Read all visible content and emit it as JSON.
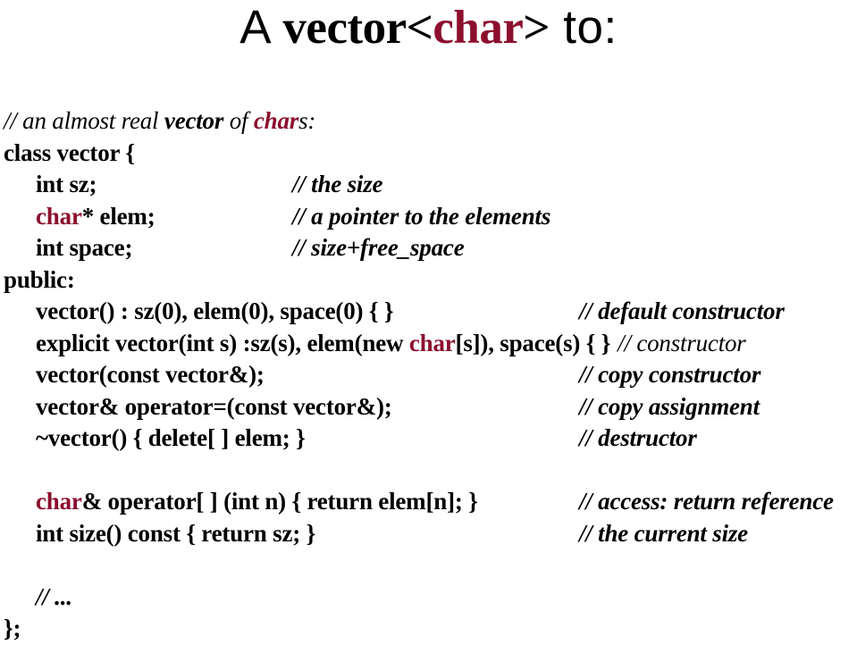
{
  "slide": {
    "title": {
      "part_a": "A ",
      "part_code_pre": "vector<",
      "part_code_red": "char",
      "part_code_post": ">",
      "part_to": " to:"
    },
    "accent_color": "#8c0f2e",
    "background_color": "#ffffff",
    "text_color": "#000000"
  },
  "code": {
    "line1_comment_pre": "// an almost real ",
    "line1_comment_vector": "vector",
    "line1_comment_of": " of ",
    "line1_comment_char": "char",
    "line1_comment_post": "s:",
    "line2": "class vector {",
    "line3_code": "int sz;",
    "line3_comment": "// the size",
    "line4_code_red": "char",
    "line4_code_rest": "* elem;",
    "line4_comment": "// a pointer to the elements",
    "line5_code": "int space;",
    "line5_comment": "// size+free_space",
    "line6": "public:",
    "line7_code": "vector() : sz(0), elem(0), space(0) { }",
    "line7_comment": "// default constructor",
    "line8_code_pre": "explicit vector(int s) :sz(s), elem(new ",
    "line8_code_red": "char",
    "line8_code_post": "[s]), space(s) { }",
    "line8_comment": "// constructor",
    "line9_code": "vector(const vector&);",
    "line9_comment": "// copy constructor",
    "line10_code": "vector& operator=(const vector&);",
    "line10_comment": "// copy assignment",
    "line11_code": "~vector() { delete[ ] elem; }",
    "line11_comment": "// destructor",
    "line12_code_red": "char",
    "line12_code_rest": "& operator[ ] (int n) { return elem[n]; }",
    "line12_comment": "// access: return reference",
    "line13_code": "int size() const { return sz; }",
    "line13_comment": "// the current size",
    "line14_comment": "// ...",
    "line15": "};"
  }
}
